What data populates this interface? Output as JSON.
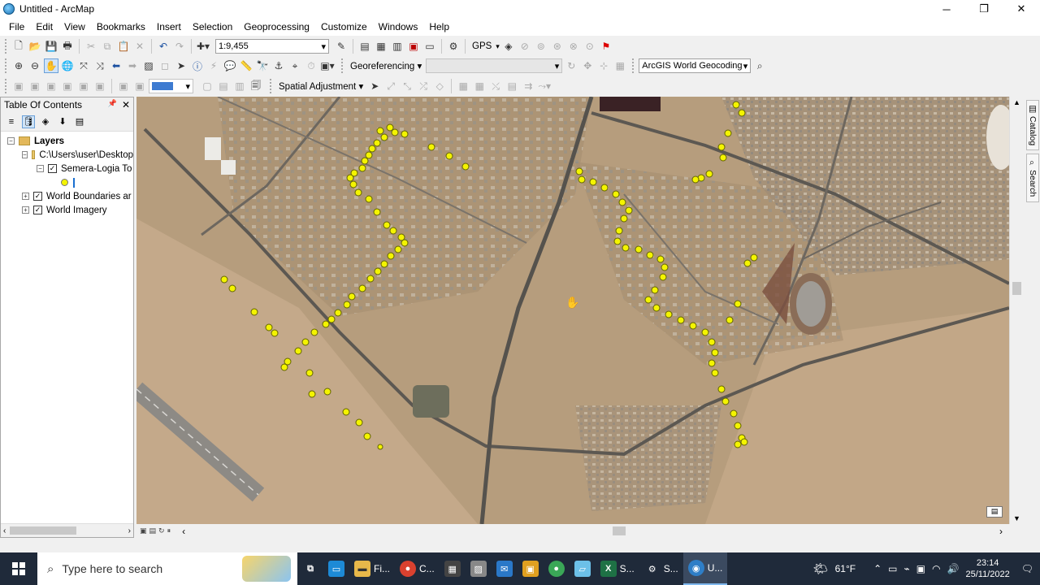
{
  "window": {
    "title": "Untitled - ArcMap",
    "min": "─",
    "max": "❐",
    "close": "✕"
  },
  "menu": [
    "File",
    "Edit",
    "View",
    "Bookmarks",
    "Insert",
    "Selection",
    "Geoprocessing",
    "Customize",
    "Windows",
    "Help"
  ],
  "toolbar1": {
    "scale": "1:9,455",
    "gps": "GPS"
  },
  "toolbar2": {
    "georeferencing": "Georeferencing",
    "geocoder": "ArcGIS World Geocoding"
  },
  "toolbar3": {
    "spatial_adjustment": "Spatial Adjustment"
  },
  "toc": {
    "title": "Table Of Contents",
    "pin": "📌",
    "close": "✕",
    "root": "Layers",
    "folder": "C:\\Users\\user\\Desktop",
    "layer1": "Semera-Logia To",
    "layer2": "World Boundaries ar",
    "layer3": "World Imagery"
  },
  "sidetabs": {
    "catalog": "Catalog",
    "search": "Search"
  },
  "taskbar": {
    "search_placeholder": "Type here to search",
    "apps": [
      {
        "label": "Fi...",
        "icon": "folder-icon"
      },
      {
        "label": "C...",
        "icon": "chrome-icon"
      },
      {
        "label": "S...",
        "icon": "excel-icon"
      },
      {
        "label": "S...",
        "icon": "settings-icon"
      },
      {
        "label": "U...",
        "icon": "arcmap-icon"
      }
    ],
    "weather": "61°F",
    "time": "23:14",
    "date": "25/11/2022"
  },
  "colors": {
    "point": "#f4f400",
    "map_bg": "#b59b7a",
    "taskbar": "#1f2a3a"
  }
}
